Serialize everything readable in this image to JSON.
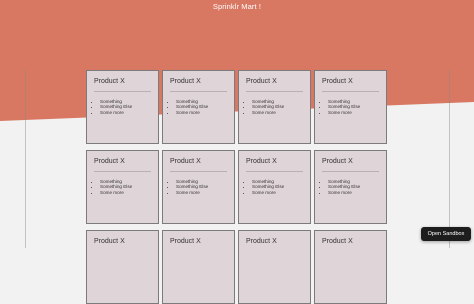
{
  "header": {
    "title": "Sprinklr Mart !"
  },
  "colors": {
    "accent": "#d97862",
    "page_bg": "#f2f2f3",
    "card_bg": "#dfd5d9"
  },
  "products": [
    {
      "title": "Product X",
      "items": [
        "Something",
        "Something Else",
        "Some more"
      ]
    },
    {
      "title": "Product X",
      "items": [
        "Something",
        "Something Else",
        "Some more"
      ]
    },
    {
      "title": "Product X",
      "items": [
        "Something",
        "Something Else",
        "Some more"
      ]
    },
    {
      "title": "Product X",
      "items": [
        "Something",
        "Something Else",
        "Some more"
      ]
    },
    {
      "title": "Product X",
      "items": [
        "Something",
        "Something Else",
        "Some more"
      ]
    },
    {
      "title": "Product X",
      "items": [
        "Something",
        "Something Else",
        "Some more"
      ]
    },
    {
      "title": "Product X",
      "items": [
        "Something",
        "Something Else",
        "Some more"
      ]
    },
    {
      "title": "Product X",
      "items": [
        "Something",
        "Something Else",
        "Some more"
      ]
    },
    {
      "title": "Product X"
    },
    {
      "title": "Product X"
    },
    {
      "title": "Product X"
    },
    {
      "title": "Product X"
    }
  ],
  "sandbox": {
    "label": "Open Sandbox"
  }
}
